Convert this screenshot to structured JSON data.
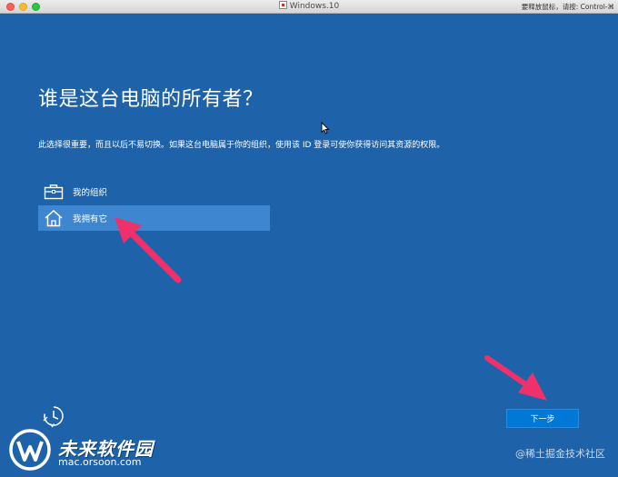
{
  "window": {
    "title": "Windows.10",
    "hint": "要释放鼠标，请按: Control-⌘"
  },
  "page": {
    "heading": "谁是这台电脑的所有者？",
    "description": "此选择很重要，而且以后不易切换。如果这台电脑属于你的组织，使用该 ID 登录可使你获得访问其资源的权限。",
    "options": [
      {
        "label": "我的组织",
        "icon": "briefcase-icon",
        "selected": false
      },
      {
        "label": "我拥有它",
        "icon": "home-icon",
        "selected": true
      }
    ],
    "next_label": "下一步",
    "accessibility_icon": "ease-of-access-icon"
  },
  "watermark": {
    "name": "未来软件园",
    "url": "mac.orsoon.com",
    "credit": "@稀土掘金技术社区"
  },
  "colors": {
    "background": "#1e63aa",
    "selected_option": "#3f86d0",
    "button": "#0078d7",
    "annotation_arrow": "#f0306a"
  }
}
